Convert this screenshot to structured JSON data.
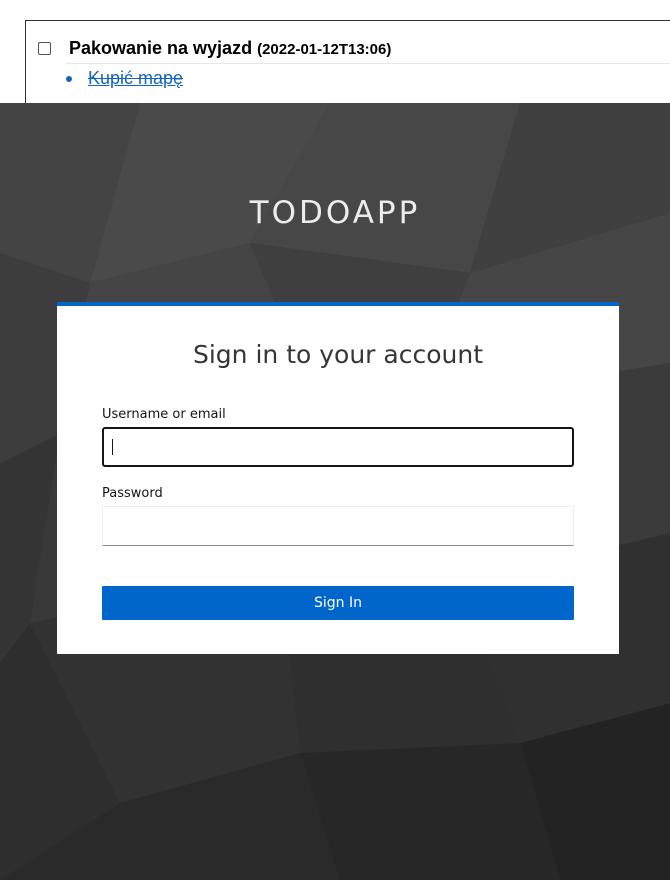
{
  "todo": {
    "title": "Pakowanie na wyjazd",
    "date": "(2022-01-12T13:06)",
    "items": [
      {
        "label": "Kupić mapę",
        "done": true
      }
    ]
  },
  "login": {
    "brand": "TODOAPP",
    "heading": "Sign in to your account",
    "username_label": "Username or email",
    "username_value": "",
    "password_label": "Password",
    "password_value": "",
    "submit_label": "Sign In"
  },
  "colors": {
    "accent": "#0066cc",
    "link": "#1565c0",
    "background": "#3a3a3a"
  },
  "icons": {
    "todo_checkbox": "checkbox-icon",
    "todo_bullet": "bullet-icon"
  }
}
